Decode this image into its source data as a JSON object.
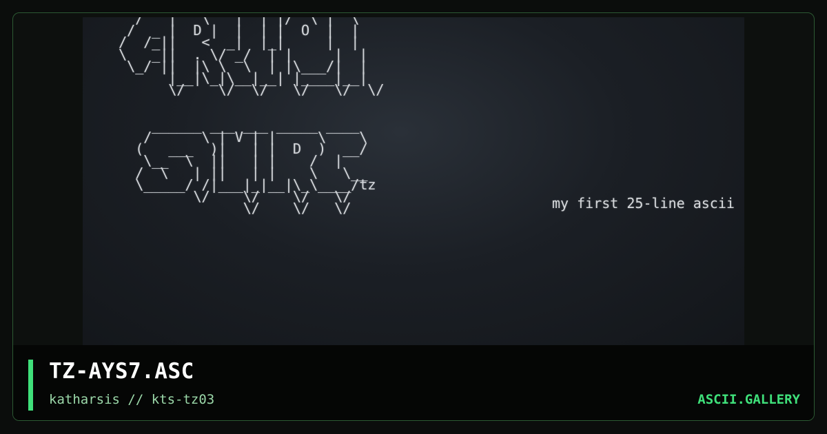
{
  "artwork": {
    "lines": [
      "  /   |   \\   |  | |/  \\ |  \\",
      " /  _ |  D |  |  | |  O  |  |",
      "/  /_||   <  _|  |_|     |  |",
      "\\   _||  . \\/ _/  | |     |  |",
      " \\_/ ||  |\\ \\  \\  | |\\___/|  |",
      "      |__|\\_|\\__|__| |____|__|",
      "      \\/    \\/  \\/   \\/   \\/  \\/",
      "",
      "",
      "    ______ ___ ___ _____ ____",
      "   /      \\ | V | |     \\    \\",
      "  (   ___  )|   | |  D  )  __/",
      "   \\__  \\  ||   | |    /  |",
      "  /  \\   | ||   | |    \\   \\__",
      "  \\_____/ /|___|_|__|\\_\\____/tz",
      "         \\/    \\/    \\/   \\/",
      "               \\/    \\/   \\/"
    ],
    "caption": "my first 25-line ascii"
  },
  "footer": {
    "title": "TZ-AYS7.ASC",
    "subtitle": "katharsis // kts-tz03",
    "brand": "ASCII.GALLERY",
    "accent_color": "#3fe07a"
  }
}
